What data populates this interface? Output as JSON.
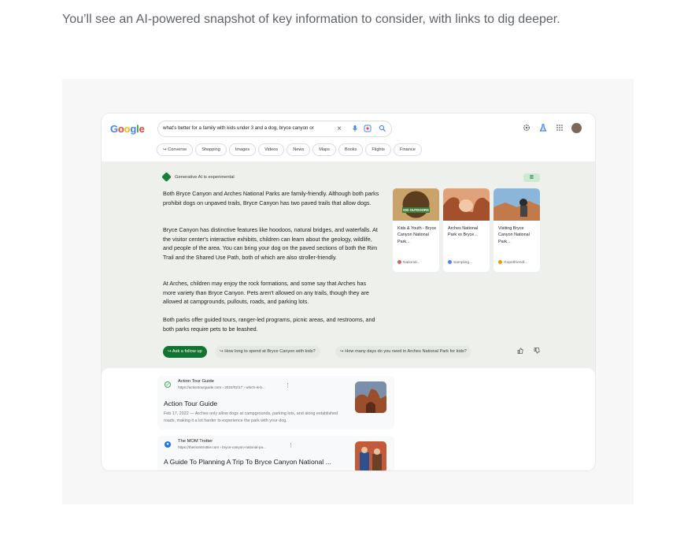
{
  "caption": "You’ll see an AI-powered snapshot of key information to consider, with links to dig deeper.",
  "colors": {
    "ai_green": "#137333",
    "panel_bg": "#eef0eb"
  },
  "header": {
    "logo": {
      "letters": [
        "G",
        "o",
        "o",
        "g",
        "l",
        "e"
      ],
      "colors": [
        "#4285F4",
        "#EA4335",
        "#FBBC05",
        "#4285F4",
        "#34A853",
        "#EA4335"
      ]
    },
    "query": "what's better for a family with kids under 3 and a dog, bryce canyon or",
    "icons": [
      "clear-icon",
      "mic-icon",
      "lens-icon",
      "search-icon",
      "settings-icon",
      "labs-icon",
      "apps-icon",
      "avatar"
    ],
    "chips": [
      "↪ Converse",
      "Shopping",
      "Images",
      "Videos",
      "News",
      "Maps",
      "Books",
      "Flights",
      "Finance"
    ]
  },
  "ai": {
    "label": "Generative AI is experimental",
    "paragraphs": [
      "Both Bryce Canyon and Arches National Parks are family-friendly. Although both parks prohibit dogs on unpaved trails, Bryce Canyon has two paved trails that allow dogs.",
      "Bryce Canyon has distinctive features like hoodoos, natural bridges, and waterfalls. At the visitor center's interactive exhibits, children can learn about the geology, wildlife, and people of the area. You can bring your dog on the paved sections of both the Rim Trail and the Shared Use Path, both of which are also stroller-friendly.",
      "At Arches, children may enjoy the rock formations, and some say that Arches has more variety than Bryce Canyon. Pets aren't allowed on any trails, though they are allowed at campgrounds, pullouts, roads, and parking lots.",
      "Both parks offer guided tours, ranger-led programs, picnic areas, and restrooms, and both parks require pets to be leashed."
    ],
    "cards": [
      {
        "title": "Kids & Youth - Bryce Canyon National Park...",
        "source": "National...",
        "img_label": "KID OUTDOORS"
      },
      {
        "title": "Arches National Park vs Bryce...",
        "source": "Sampling..."
      },
      {
        "title": "Visiting Bryce Canyon National Park...",
        "source": "Gopetfriendl..."
      }
    ],
    "follow_up": "↪ Ask a follow up",
    "suggestions": [
      "↪ How long to spend at Bryce Canyon with kids?",
      "↪ How many days do you need in Arches National Park for kids?"
    ]
  },
  "results": [
    {
      "site": "Action Tour Guide",
      "url": "https://actiontourguide.com › 2022/02/17 › which-is-b...",
      "title": "Action Tour Guide",
      "snippet": "Feb 17, 2022 — Arches only allow dogs at campgrounds, parking lots, and along established roads, making it a lot harder to experience the park with your dog."
    },
    {
      "site": "The MOM Trotter",
      "url": "https://themomtrotter.com › bryce-canyon-national-pa...",
      "title": "A Guide To Planning A Trip To Bryce Canyon National ..."
    }
  ]
}
